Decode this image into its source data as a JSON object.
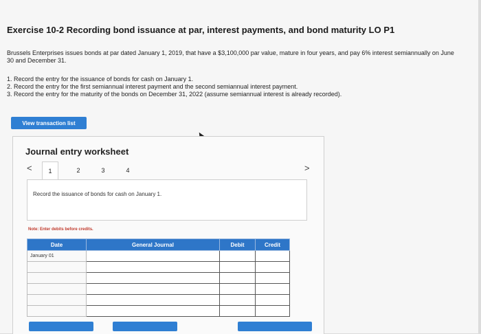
{
  "exercise": {
    "title": "Exercise 10-2 Recording bond issuance at par, interest payments, and bond maturity LO P1",
    "intro": "Brussels Enterprises issues bonds at par dated January 1, 2019, that have a $3,100,000 par value, mature in four years, and pay 6% interest semiannually on June 30 and December 31.",
    "tasks": [
      "1. Record the entry for the issuance of bonds for cash on January 1.",
      "2. Record the entry for the first semiannual interest payment and the second semiannual interest payment.",
      "3. Record the entry for the maturity of the bonds on December 31, 2022 (assume semiannual interest is already recorded)."
    ]
  },
  "buttons": {
    "view_transaction_list": "View transaction list"
  },
  "worksheet": {
    "title": "Journal entry worksheet",
    "nav_prev": "<",
    "nav_next": ">",
    "tabs": [
      "1",
      "2",
      "3",
      "4"
    ],
    "active_tab": "1",
    "instruction": "Record the issuance of bonds for cash on January 1.",
    "note_label": "Note:",
    "note_text": "Enter debits before credits.",
    "table": {
      "headers": [
        "Date",
        "General Journal",
        "Debit",
        "Credit"
      ],
      "rows": [
        [
          "January 01",
          "",
          "",
          ""
        ],
        [
          "",
          "",
          "",
          ""
        ],
        [
          "",
          "",
          "",
          ""
        ],
        [
          "",
          "",
          "",
          ""
        ],
        [
          "",
          "",
          "",
          ""
        ],
        [
          "",
          "",
          "",
          ""
        ]
      ]
    }
  },
  "colors": {
    "accent": "#2f7fd3",
    "header_bg": "#2e76c8",
    "note_red": "#c0392b"
  }
}
